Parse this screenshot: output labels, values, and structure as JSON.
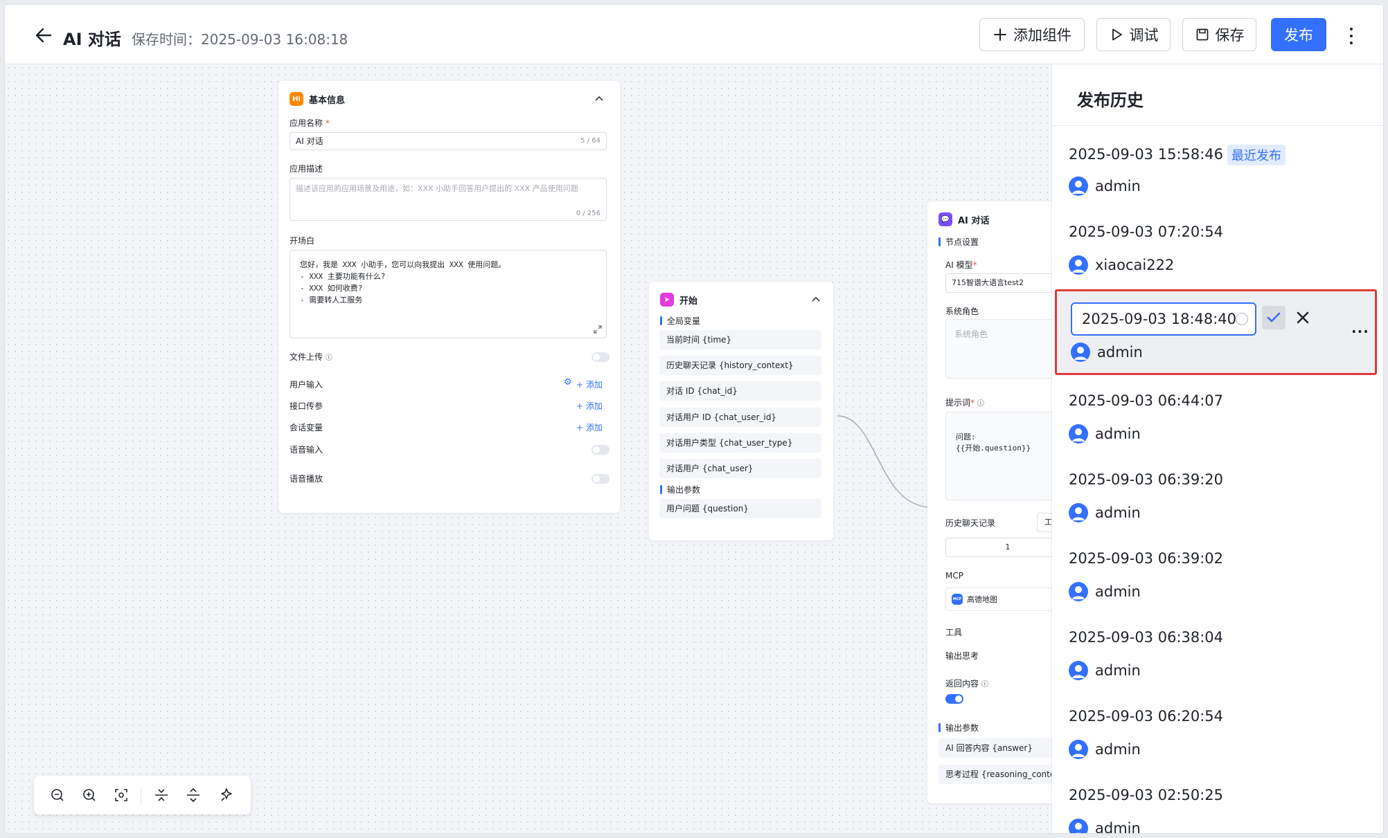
{
  "header": {
    "back_icon": "arrow-left-icon",
    "title": "AI 对话",
    "save_time": "保存时间：2025-09-03 16:08:18",
    "add_component_label": "添加组件",
    "debug_label": "调试",
    "save_label": "保存",
    "publish_label": "发布",
    "primary_color": "#3370ff"
  },
  "basic_info": {
    "title": "基本信息",
    "badge": "Hi",
    "app_name_label": "应用名称",
    "app_name_value": "AI 对话",
    "app_name_count": "5 / 64",
    "desc_label": "应用描述",
    "desc_placeholder": "描述该应用的应用场景及用途，如：XXX 小助手回答用户提出的 XXX 产品使用问题",
    "desc_count": "0 / 256",
    "prologue_label": "开场白",
    "prologue_lines": [
      "您好，我是 XXX 小助手，您可以向我提出 XXX 使用问题。",
      "- XXX 主要功能有什么?",
      "- XXX 如何收费?",
      "- 需要转人工服务"
    ],
    "file_upload_label": "文件上传",
    "user_input_label": "用户输入",
    "api_param_label": "接口传参",
    "session_var_label": "会话变量",
    "voice_input_label": "语音输入",
    "voice_play_label": "语音播放",
    "add_label": "添加"
  },
  "start_node": {
    "title": "开始",
    "global_vars_label": "全局变量",
    "global_vars": [
      "当前时间 {time}",
      "历史聊天记录 {history_context}",
      "对话 ID {chat_id}",
      "对话用户 ID {chat_user_id}",
      "对话用户类型 {chat_user_type}",
      "对话用户 {chat_user}"
    ],
    "output_label": "输出参数",
    "outputs": [
      "用户问题 {question}"
    ]
  },
  "ai_node": {
    "title": "AI 对话",
    "node_settings": "节点设置",
    "model_label": "AI 模型",
    "model_value": "715智谱大语言test2",
    "system_role_label": "系统角色",
    "system_role_placeholder": "系统角色",
    "prompt_label": "提示词",
    "prompt_lines": [
      "问题:",
      "{{开始.question}}"
    ],
    "history_label": "历史聊天记录",
    "history_select": "工",
    "history_value": "1",
    "mcp_label": "MCP",
    "mcp_value": "高德地图",
    "mcp_badge": "MCP",
    "tools_label": "工具",
    "output_thinking_label": "输出思考",
    "return_content_label": "返回内容",
    "output_params_label": "输出参数",
    "outputs": [
      "AI 回答内容 {answer}",
      "思考过程 {reasoning_conter"
    ]
  },
  "history_panel": {
    "title": "发布历史",
    "recent_tag": "最近发布",
    "editing_value": "2025-09-03 18:48:40",
    "items": [
      {
        "date": "2025-09-03 15:58:46",
        "user": "admin"
      },
      {
        "date": "2025-09-03 07:20:54",
        "user": "xiaocai222"
      },
      {
        "date": "2025-09-03 18:48:40",
        "user": "admin"
      },
      {
        "date": "2025-09-03 06:44:07",
        "user": "admin"
      },
      {
        "date": "2025-09-03 06:39:20",
        "user": "admin"
      },
      {
        "date": "2025-09-03 06:39:02",
        "user": "admin"
      },
      {
        "date": "2025-09-03 06:38:04",
        "user": "admin"
      },
      {
        "date": "2025-09-03 06:20:54",
        "user": "admin"
      },
      {
        "date": "2025-09-03 02:50:25",
        "user": "admin"
      }
    ]
  },
  "toolbar": {
    "icons": [
      "zoom-out-icon",
      "zoom-in-icon",
      "fit-view-icon",
      "collapse-all-icon",
      "expand-all-icon",
      "beautify-icon"
    ]
  }
}
